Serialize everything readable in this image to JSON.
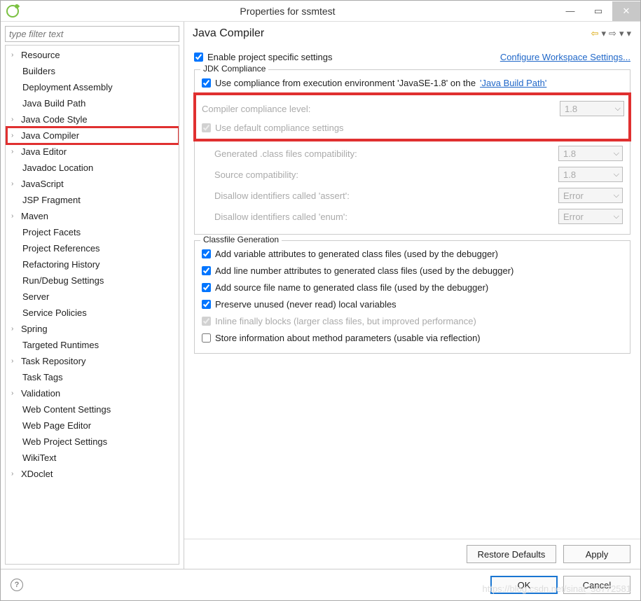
{
  "window": {
    "title": "Properties for ssmtest"
  },
  "filter": {
    "placeholder": "type filter text"
  },
  "tree": [
    {
      "label": "Resource",
      "expandable": true,
      "child": false
    },
    {
      "label": "Builders",
      "expandable": false,
      "child": true
    },
    {
      "label": "Deployment Assembly",
      "expandable": false,
      "child": true
    },
    {
      "label": "Java Build Path",
      "expandable": false,
      "child": true
    },
    {
      "label": "Java Code Style",
      "expandable": true,
      "child": false
    },
    {
      "label": "Java Compiler",
      "expandable": true,
      "child": false,
      "highlighted": true
    },
    {
      "label": "Java Editor",
      "expandable": true,
      "child": false
    },
    {
      "label": "Javadoc Location",
      "expandable": false,
      "child": true
    },
    {
      "label": "JavaScript",
      "expandable": true,
      "child": false
    },
    {
      "label": "JSP Fragment",
      "expandable": false,
      "child": true
    },
    {
      "label": "Maven",
      "expandable": true,
      "child": false
    },
    {
      "label": "Project Facets",
      "expandable": false,
      "child": true
    },
    {
      "label": "Project References",
      "expandable": false,
      "child": true
    },
    {
      "label": "Refactoring History",
      "expandable": false,
      "child": true
    },
    {
      "label": "Run/Debug Settings",
      "expandable": false,
      "child": true
    },
    {
      "label": "Server",
      "expandable": false,
      "child": true
    },
    {
      "label": "Service Policies",
      "expandable": false,
      "child": true
    },
    {
      "label": "Spring",
      "expandable": true,
      "child": false
    },
    {
      "label": "Targeted Runtimes",
      "expandable": false,
      "child": true
    },
    {
      "label": "Task Repository",
      "expandable": true,
      "child": false
    },
    {
      "label": "Task Tags",
      "expandable": false,
      "child": true
    },
    {
      "label": "Validation",
      "expandable": true,
      "child": false
    },
    {
      "label": "Web Content Settings",
      "expandable": false,
      "child": true
    },
    {
      "label": "Web Page Editor",
      "expandable": false,
      "child": true
    },
    {
      "label": "Web Project Settings",
      "expandable": false,
      "child": true
    },
    {
      "label": "WikiText",
      "expandable": false,
      "child": true
    },
    {
      "label": "XDoclet",
      "expandable": true,
      "child": false
    }
  ],
  "panel": {
    "title": "Java Compiler",
    "enable_label": "Enable project specific settings",
    "configure_link": "Configure Workspace Settings..."
  },
  "jdk": {
    "legend": "JDK Compliance",
    "use_exec_prefix": "Use compliance from execution environment 'JavaSE-1.8' on the ",
    "use_exec_link": "'Java Build Path'",
    "compliance_label": "Compiler compliance level:",
    "compliance_value": "1.8",
    "use_default_label": "Use default compliance settings",
    "gen_class_label": "Generated .class files compatibility:",
    "gen_class_value": "1.8",
    "src_compat_label": "Source compatibility:",
    "src_compat_value": "1.8",
    "assert_label": "Disallow identifiers called 'assert':",
    "assert_value": "Error",
    "enum_label": "Disallow identifiers called 'enum':",
    "enum_value": "Error"
  },
  "classfile": {
    "legend": "Classfile Generation",
    "add_var": "Add variable attributes to generated class files (used by the debugger)",
    "add_line": "Add line number attributes to generated class files (used by the debugger)",
    "add_src": "Add source file name to generated class file (used by the debugger)",
    "preserve": "Preserve unused (never read) local variables",
    "inline": "Inline finally blocks (larger class files, but improved performance)",
    "store_params": "Store information about method parameters (usable via reflection)"
  },
  "buttons": {
    "restore": "Restore Defaults",
    "apply": "Apply",
    "ok": "OK",
    "cancel": "Cancel"
  },
  "watermark": "https://blog.csdn.net/sinat_38772581"
}
